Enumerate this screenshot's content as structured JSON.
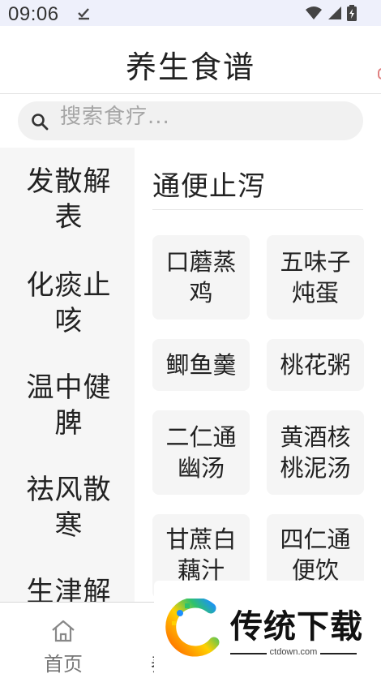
{
  "status_bar": {
    "time": "09:06"
  },
  "header": {
    "title": "养生食谱"
  },
  "search": {
    "placeholder": "搜索食疗..."
  },
  "sidebar": {
    "items": [
      {
        "label": "发散解表"
      },
      {
        "label": "化痰止咳"
      },
      {
        "label": "温中健脾"
      },
      {
        "label": "祛风散寒"
      },
      {
        "label": "生津解"
      }
    ]
  },
  "content": {
    "section_title": "通便止泻",
    "recipes": [
      {
        "name": "口蘑蒸鸡"
      },
      {
        "name": "五味子炖蛋"
      },
      {
        "name": "鲫鱼羹"
      },
      {
        "name": "桃花粥"
      },
      {
        "name": "二仁通幽汤"
      },
      {
        "name": "黄酒核桃泥汤"
      },
      {
        "name": "甘蔗白藕汁"
      },
      {
        "name": "四仁通便饮"
      }
    ]
  },
  "tabbar": {
    "home_label": "首页",
    "second_label": "养"
  },
  "watermark": {
    "brand": "传统下载",
    "url": "ctdown.com"
  },
  "colors": {
    "status_bg": "#eef0fb",
    "sidebar_bg": "#f6f6f6",
    "card_bg": "#f5f5f5",
    "search_bg": "#f1f1f1"
  }
}
